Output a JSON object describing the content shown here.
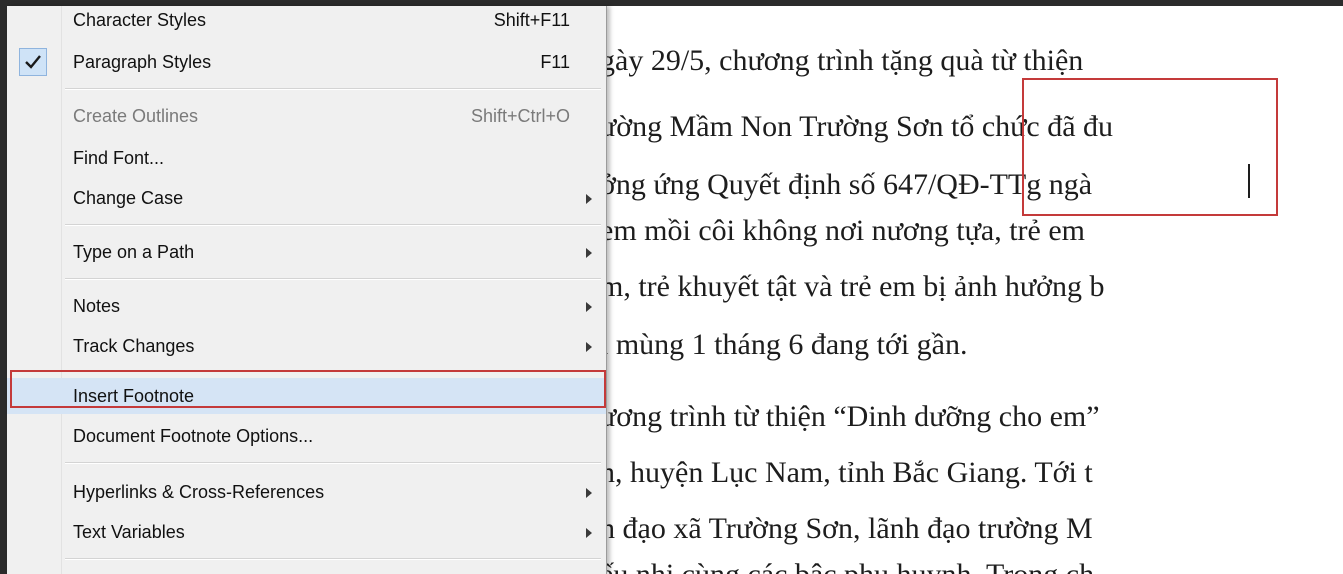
{
  "menu": {
    "items": [
      {
        "label": "Character Styles",
        "shortcut": "Shift+F11"
      },
      {
        "label": "Paragraph Styles",
        "shortcut": "F11",
        "checked": true
      },
      {
        "label": "Create Outlines",
        "shortcut": "Shift+Ctrl+O",
        "disabled": true
      },
      {
        "label": "Find Font..."
      },
      {
        "label": "Change Case",
        "submenu": true
      },
      {
        "label": "Type on a Path",
        "submenu": true
      },
      {
        "label": "Notes",
        "submenu": true
      },
      {
        "label": "Track Changes",
        "submenu": true
      },
      {
        "label": "Insert Footnote",
        "highlighted": true
      },
      {
        "label": "Document Footnote Options..."
      },
      {
        "label": "Hyperlinks & Cross-References",
        "submenu": true
      },
      {
        "label": "Text Variables",
        "submenu": true
      }
    ]
  },
  "document": {
    "lines": [
      "gày 29/5,  chương trình tặng quà từ thiện",
      "ường Mầm Non Trường Sơn tổ chức đã đu",
      "ởng ứng Quyết định số 647/QĐ-TTg ngà",
      " em mồi côi không nơi nương tựa, trẻ em",
      "m, trẻ khuyết tật và trẻ em bị ảnh hưởng b",
      "i mùng 1 tháng 6 đang tới gần.",
      "ương trình từ thiện “Dinh dưỡng cho em”",
      "n, huyện Lục Nam, tỉnh Bắc Giang. Tới t",
      "h đạo xã Trường Sơn, lãnh đạo trường M",
      "ếu nhi cùng các bậc phụ huynh. Trong ch"
    ]
  },
  "colors": {
    "highlight_outline": "#c43a3a",
    "hover_fill": "#d5e4f5",
    "check_fill": "#cfe3f7"
  }
}
